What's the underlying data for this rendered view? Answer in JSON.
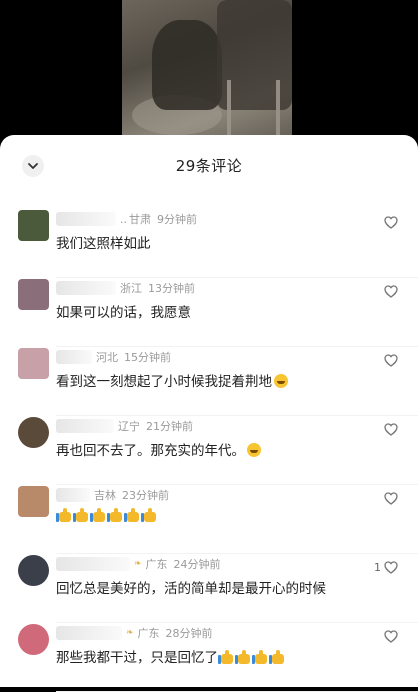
{
  "video": {
    "description_icon": "video-preview"
  },
  "sheet": {
    "title": "29条评论",
    "collapse_icon": "chevron-down-icon"
  },
  "comments": [
    {
      "name_visible": "..",
      "location": "甘肃",
      "time": "9分钟前",
      "text": "我们这照样如此",
      "likes": "",
      "emoji": "",
      "thumbs": 0,
      "avatar_color": "#4a5a3a"
    },
    {
      "name_visible": "",
      "location": "浙江",
      "time": "13分钟前",
      "text": "如果可以的话，我愿意",
      "likes": "",
      "emoji": "",
      "thumbs": 0,
      "avatar_color": "#8a6f7a"
    },
    {
      "name_visible": "",
      "location": "河北",
      "time": "15分钟前",
      "text": "看到这一刻想起了小时候我捉着荆地",
      "likes": "",
      "emoji": "laughing-tears",
      "thumbs": 0,
      "avatar_color": "#c8a0a8"
    },
    {
      "name_visible": "",
      "location": "辽宁",
      "time": "21分钟前",
      "text": "再也回不去了。那充实的年代。",
      "likes": "",
      "emoji": "laughing-tears",
      "thumbs": 0,
      "avatar_color": "#5a4a3a"
    },
    {
      "name_visible": "",
      "location": "吉林",
      "time": "23分钟前",
      "text": "",
      "likes": "",
      "emoji": "",
      "thumbs": 6,
      "avatar_color": "#b88a6a"
    },
    {
      "name_visible": "",
      "location": "广东",
      "time": "24分钟前",
      "text": "回忆总是美好的，活的简单却是最开心的时候",
      "likes": "1",
      "emoji": "",
      "thumbs": 0,
      "avatar_color": "#3a3f4a",
      "badge": true
    },
    {
      "name_visible": "",
      "location": "广东",
      "time": "28分钟前",
      "text": "那些我都干过，只是回忆了",
      "likes": "",
      "emoji": "",
      "thumbs": 4,
      "avatar_color": "#d06a7a",
      "badge": true
    }
  ]
}
